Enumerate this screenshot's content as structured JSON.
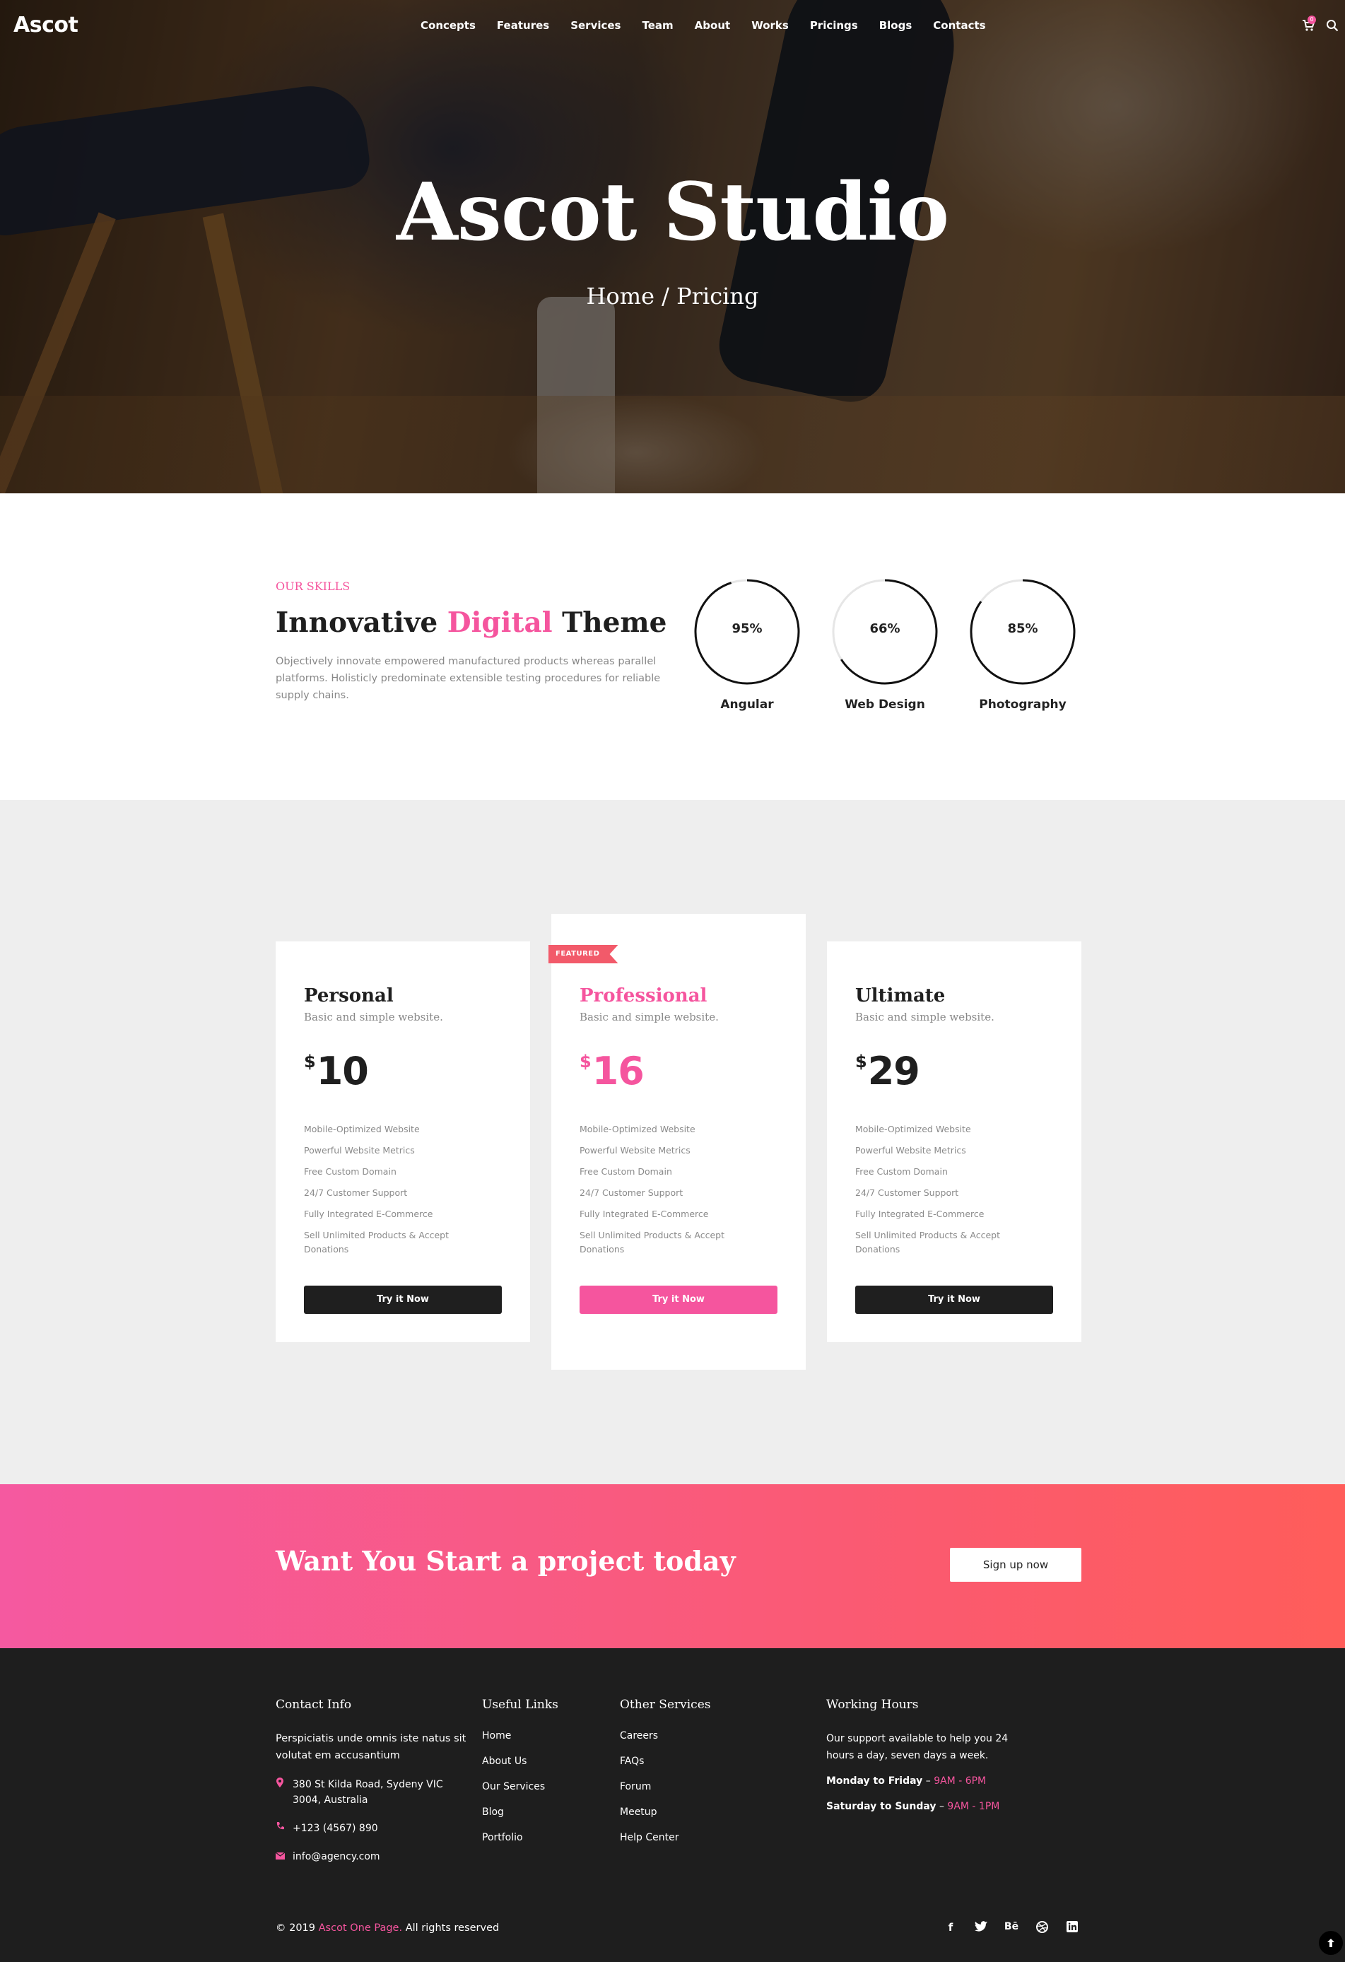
{
  "nav": {
    "logo": "Ascot",
    "items": [
      "Concepts",
      "Features",
      "Services",
      "Team",
      "About",
      "Works",
      "Pricings",
      "Blogs",
      "Contacts"
    ],
    "cart_count": "0",
    "icons": [
      "cart-icon",
      "search-icon"
    ]
  },
  "hero": {
    "title": "Ascot Studio",
    "breadcrumb": "Home / Pricing"
  },
  "skills": {
    "eyebrow": "OUR SKILLS",
    "heading_pre": "Innovative ",
    "heading_hl": "Digital",
    "heading_post": " Theme",
    "description": "Objectively innovate empowered manufactured products whereas parallel platforms. Holisticly predominate extensible testing procedures for reliable supply chains.",
    "rings": [
      {
        "label": "Angular",
        "percent_text": "95%",
        "value": 0.95
      },
      {
        "label": "Web Design",
        "percent_text": "66%",
        "value": 0.66
      },
      {
        "label": "Photography",
        "percent_text": "85%",
        "value": 0.85
      }
    ]
  },
  "pricing": {
    "features": [
      "Mobile-Optimized Website",
      "Powerful Website Metrics",
      "Free Custom Domain",
      "24/7 Customer Support",
      "Fully Integrated E-Commerce",
      "Sell Unlimited Products & Accept Donations"
    ],
    "plans": [
      {
        "name": "Personal",
        "subtitle": "Basic and simple website.",
        "currency": "$",
        "price": "10",
        "button": "Try it Now"
      },
      {
        "name": "Professional",
        "subtitle": "Basic and simple website.",
        "currency": "$",
        "price": "16",
        "button": "Try it Now",
        "badge": "FEATURED"
      },
      {
        "name": "Ultimate",
        "subtitle": "Basic and simple website.",
        "currency": "$",
        "price": "29",
        "button": "Try it Now"
      }
    ]
  },
  "cta": {
    "heading": "Want You Start a project today",
    "button": "Sign up now"
  },
  "footer": {
    "contact": {
      "title": "Contact Info",
      "text": "Perspiciatis unde omnis iste natus sit volutat em accusantium",
      "address": "380 St Kilda Road, Sydeny VIC 3004, Australia",
      "phone": "+123 (4567) 890",
      "email": "info@agency.com"
    },
    "useful": {
      "title": "Useful Links",
      "links": [
        "Home",
        "About Us",
        "Our Services",
        "Blog",
        "Portfolio"
      ]
    },
    "other": {
      "title": "Other Services",
      "links": [
        "Careers",
        "FAQs",
        "Forum",
        "Meetup",
        "Help Center"
      ]
    },
    "hours": {
      "title": "Working Hours",
      "text": "Our support available to help you 24 hours a day, seven days a week.",
      "weekday_label": "Monday to Friday",
      "weekday_time": "9AM - 6PM",
      "weekend_label": "Saturday to Sunday",
      "weekend_time": "9AM - 1PM"
    },
    "copyright_pre": "© 2019 ",
    "copyright_link": "Ascot One Page.",
    "copyright_post": " All rights reserved",
    "socials": [
      "facebook-icon",
      "twitter-icon",
      "behance-icon",
      "dribbble-icon",
      "linkedin-icon"
    ]
  },
  "colors": {
    "accent": "#f5559e",
    "dark": "#1f1f1f",
    "footer_bg": "#1e1e1e",
    "pricing_bg": "#eeeeee"
  }
}
